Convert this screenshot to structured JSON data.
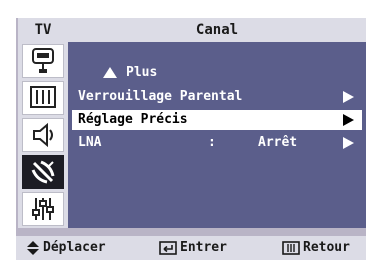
{
  "sidebar": {
    "tv_label": "TV",
    "icons": [
      {
        "name": "input-connector-icon",
        "active": false
      },
      {
        "name": "picture-bars-icon",
        "active": false
      },
      {
        "name": "speaker-icon",
        "active": false
      },
      {
        "name": "satellite-dish-icon",
        "active": true
      },
      {
        "name": "settings-sliders-icon",
        "active": false
      }
    ]
  },
  "header": {
    "title": "Canal"
  },
  "menu": {
    "more_label": "Plus",
    "items": [
      {
        "label": "Verrouillage Parental",
        "colon": "",
        "value": "",
        "selected": false
      },
      {
        "label": "Réglage Précis",
        "colon": "",
        "value": "",
        "selected": true
      },
      {
        "label": "LNA",
        "colon": ":",
        "value": "Arrêt",
        "selected": false
      }
    ]
  },
  "footer": {
    "move_label": "Déplacer",
    "enter_label": "Entrer",
    "return_label": "Retour"
  },
  "colors": {
    "content_bg": "#5b5e8b",
    "bar_bg": "#dcdce6",
    "outer_bg": "#b9b4c6",
    "highlight_bg": "#ffffff"
  }
}
